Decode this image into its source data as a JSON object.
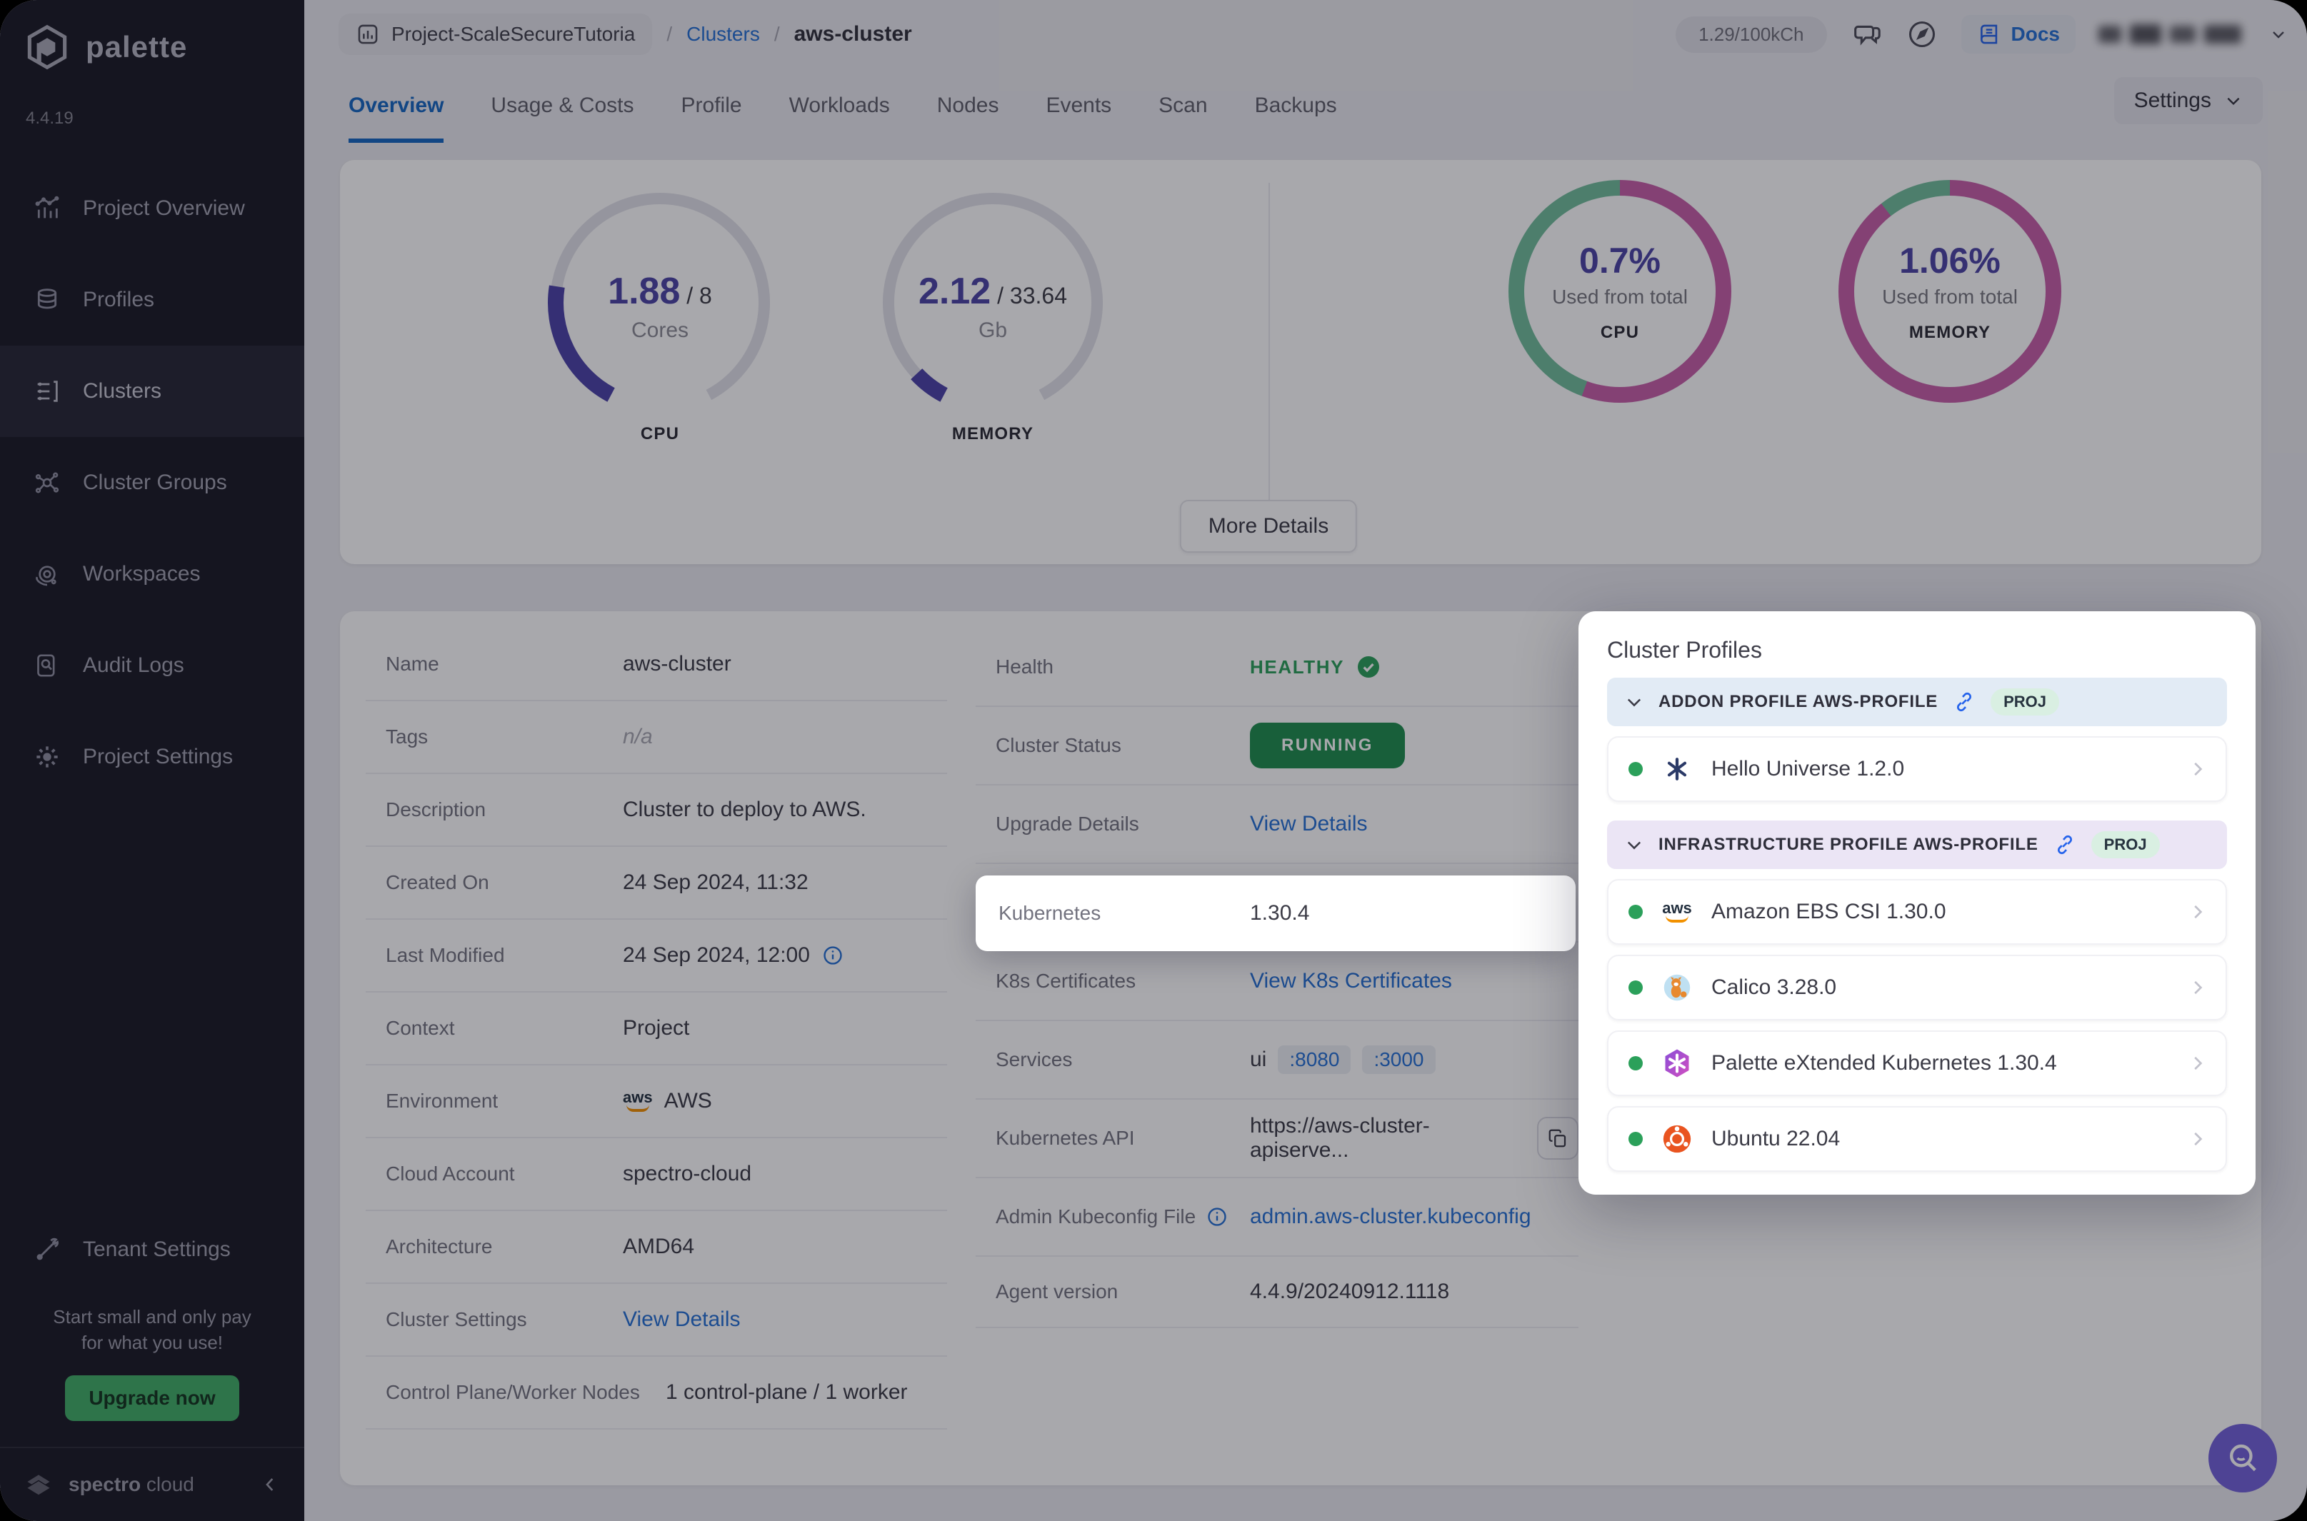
{
  "brand": {
    "name": "palette",
    "version": "4.4.19",
    "footer_bold": "spectro",
    "footer_rest": " cloud"
  },
  "sidebar": {
    "items": [
      {
        "label": "Project Overview"
      },
      {
        "label": "Profiles"
      },
      {
        "label": "Clusters"
      },
      {
        "label": "Cluster Groups"
      },
      {
        "label": "Workspaces"
      },
      {
        "label": "Audit Logs"
      },
      {
        "label": "Project Settings"
      }
    ],
    "tenant_settings": "Tenant Settings",
    "promo": {
      "line1": "Start small and only pay",
      "line2": "for what you use!",
      "cta": "Upgrade now"
    }
  },
  "header": {
    "project": "Project-ScaleSecureTutoria",
    "sep": "/",
    "breadcrumb_clusters": "Clusters",
    "breadcrumb_current": "aws-cluster",
    "usage": "1.29/100kCh",
    "docs": "Docs"
  },
  "tabs": {
    "items": [
      {
        "label": "Overview"
      },
      {
        "label": "Usage & Costs"
      },
      {
        "label": "Profile"
      },
      {
        "label": "Workloads"
      },
      {
        "label": "Nodes"
      },
      {
        "label": "Events"
      },
      {
        "label": "Scan"
      },
      {
        "label": "Backups"
      }
    ],
    "settings": "Settings"
  },
  "overview": {
    "gauges": {
      "cpu": {
        "used": "1.88",
        "total": " / 8",
        "unit": "Cores",
        "caption": "CPU"
      },
      "memory": {
        "used": "2.12",
        "total": " / 33.64",
        "unit": "Gb",
        "caption": "MEMORY"
      }
    },
    "donuts": {
      "cpu": {
        "pct": "0.7%",
        "sub": "Used from total",
        "caption": "CPU"
      },
      "memory": {
        "pct": "1.06%",
        "sub": "Used from total",
        "caption": "MEMORY"
      }
    },
    "more_details": "More Details"
  },
  "details": {
    "left": [
      {
        "label": "Name",
        "value": "aws-cluster"
      },
      {
        "label": "Tags",
        "value": "n/a"
      },
      {
        "label": "Description",
        "value": "Cluster to deploy to AWS."
      },
      {
        "label": "Created On",
        "value": "24 Sep 2024, 11:32"
      },
      {
        "label": "Last Modified",
        "value": "24 Sep 2024, 12:00"
      },
      {
        "label": "Context",
        "value": "Project"
      },
      {
        "label": "Environment",
        "value": "AWS"
      },
      {
        "label": "Cloud Account",
        "value": "spectro-cloud"
      },
      {
        "label": "Architecture",
        "value": "AMD64"
      },
      {
        "label": "Cluster Settings",
        "value": "View Details"
      },
      {
        "label": "Control Plane/Worker Nodes",
        "value": "1 control-plane / 1 worker"
      }
    ],
    "right": [
      {
        "label": "Health",
        "value": "HEALTHY"
      },
      {
        "label": "Cluster Status",
        "value": "RUNNING"
      },
      {
        "label": "Upgrade Details",
        "value": "View Details"
      },
      {
        "label": "Kubernetes",
        "value": "1.30.4"
      },
      {
        "label": "K8s Certificates",
        "value": "View K8s Certificates"
      },
      {
        "label": "Services",
        "value": "ui",
        "port1": ":8080",
        "port2": ":3000"
      },
      {
        "label": "Kubernetes API",
        "value": "https://aws-cluster-apiserve..."
      },
      {
        "label": "Admin Kubeconfig File",
        "value": "admin.aws-cluster.kubeconfig"
      },
      {
        "label": "Agent version",
        "value": "4.4.9/20240912.1118"
      }
    ]
  },
  "highlight": {
    "label": "Kubernetes",
    "value": "1.30.4"
  },
  "cluster_profiles": {
    "title": "Cluster Profiles",
    "sections": [
      {
        "header": "ADDON PROFILE AWS-PROFILE",
        "badge": "PROJ",
        "items": [
          {
            "name": "Hello Universe 1.2.0"
          }
        ]
      },
      {
        "header": "INFRASTRUCTURE PROFILE AWS-PROFILE",
        "badge": "PROJ",
        "items": [
          {
            "name": "Amazon EBS CSI 1.30.0"
          },
          {
            "name": "Calico 3.28.0"
          },
          {
            "name": "Palette eXtended Kubernetes 1.30.4"
          },
          {
            "name": "Ubuntu 22.04"
          }
        ]
      }
    ]
  },
  "colors": {
    "accent_purple": "#4B44A5",
    "donut_magenta": "#C75FA8",
    "donut_green": "#71BD9B",
    "link_blue": "#2570D4",
    "running_green": "#1E8E4D",
    "healthy_green": "#2BA05A",
    "upgrade_green": "#41AE67",
    "fab_purple": "#7361D9",
    "sidebar_bg": "#191925"
  }
}
